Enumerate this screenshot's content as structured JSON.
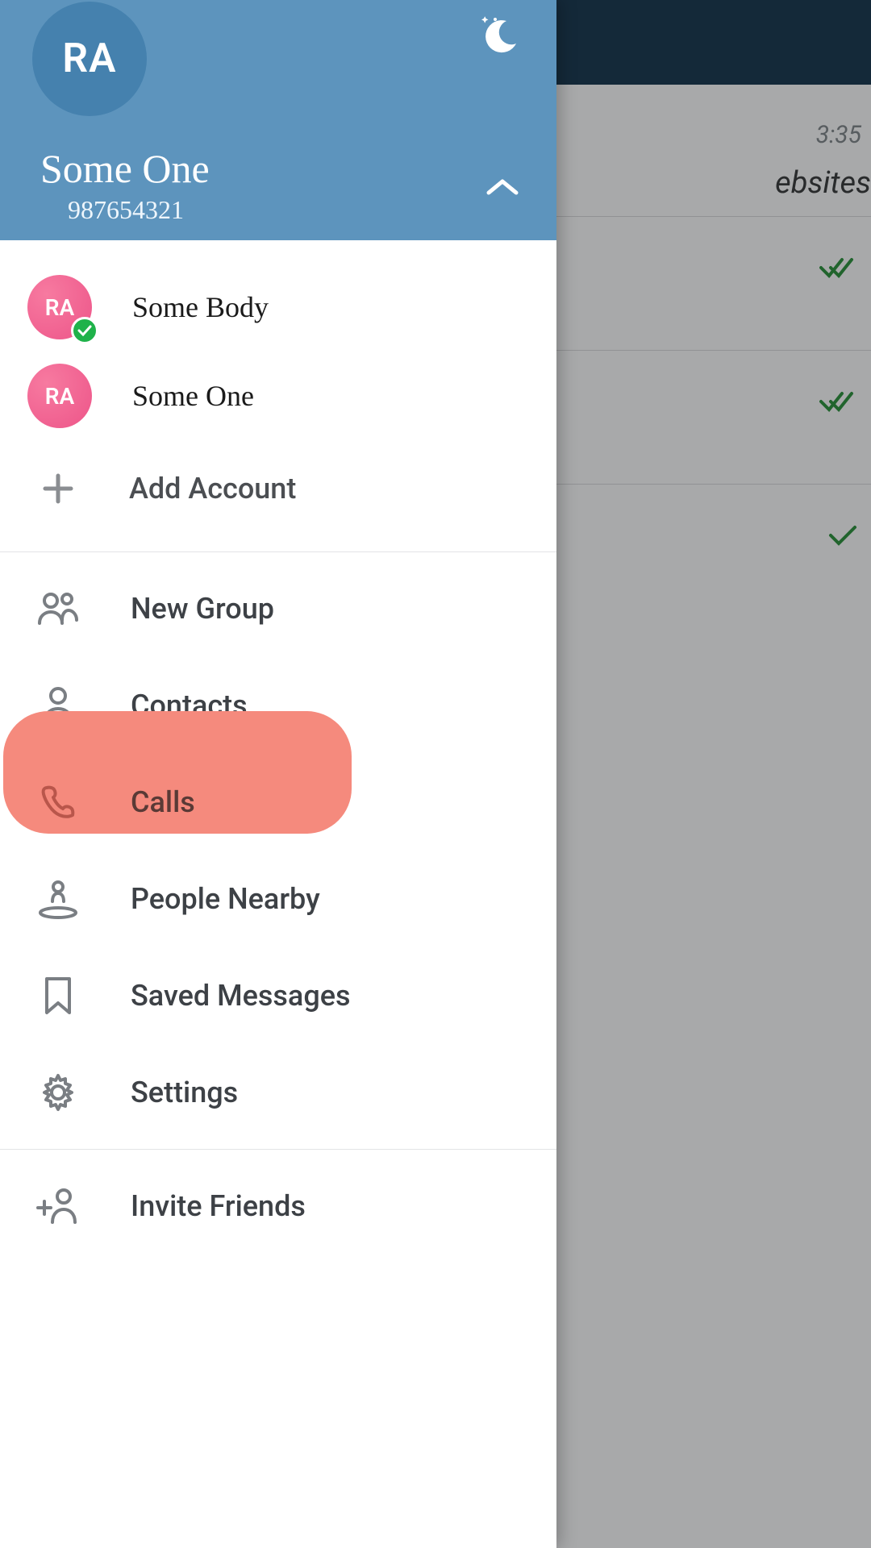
{
  "background": {
    "time": "3:35",
    "preview_text": "ebsites"
  },
  "header": {
    "avatar_initials": "RA",
    "profile_name": "Some One",
    "profile_phone": "987654321"
  },
  "accounts": [
    {
      "initials": "RA",
      "name": "Some Body",
      "active": true
    },
    {
      "initials": "RA",
      "name": "Some One",
      "active": false
    }
  ],
  "add_account_label": "Add Account",
  "menu": {
    "new_group": "New Group",
    "contacts": "Contacts",
    "calls": "Calls",
    "people_nearby": "People Nearby",
    "saved_messages": "Saved Messages",
    "settings": "Settings",
    "invite_friends": "Invite Friends"
  }
}
